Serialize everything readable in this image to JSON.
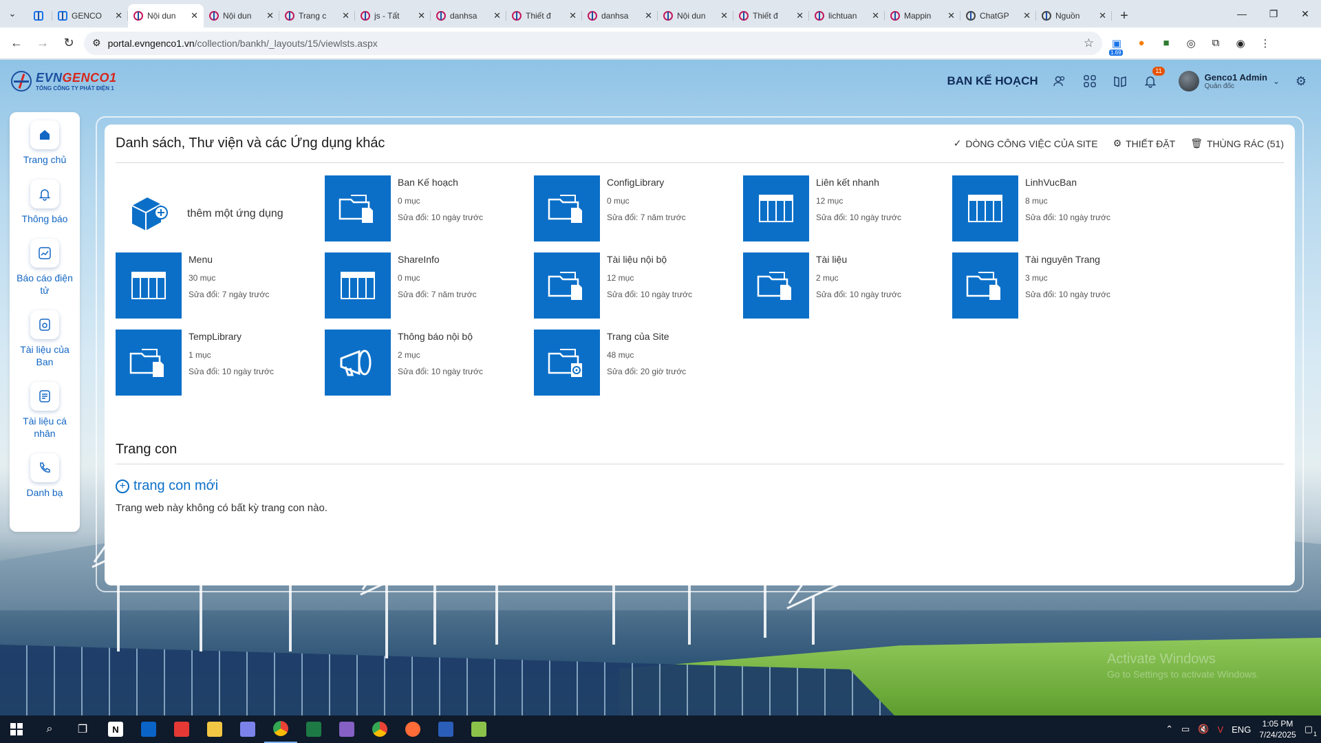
{
  "browser": {
    "tabs": [
      {
        "label": "",
        "icon": "teams-icon",
        "pinned": true
      },
      {
        "label": "GENCO",
        "icon": "sharepoint-icon"
      },
      {
        "label": "Nội dun",
        "icon": "evn-favicon",
        "active": true
      },
      {
        "label": "Nội dun",
        "icon": "evn-favicon"
      },
      {
        "label": "Trang c",
        "icon": "evn-favicon"
      },
      {
        "label": "js - Tất",
        "icon": "evn-favicon"
      },
      {
        "label": "danhsa",
        "icon": "evn-favicon"
      },
      {
        "label": "Thiết đ",
        "icon": "evn-favicon"
      },
      {
        "label": "danhsa",
        "icon": "evn-favicon"
      },
      {
        "label": "Nội dun",
        "icon": "evn-favicon"
      },
      {
        "label": "Thiết đ",
        "icon": "evn-favicon"
      },
      {
        "label": "lichtuan",
        "icon": "evn-favicon"
      },
      {
        "label": "Mappin",
        "icon": "evn-favicon"
      },
      {
        "label": "ChatGP",
        "icon": "chatgpt-icon"
      },
      {
        "label": "Nguồn",
        "icon": "chatgpt-icon"
      }
    ],
    "url_host": "portal.evngenco1.vn",
    "url_path": "/collection/bankh/_layouts/15/viewlsts.aspx",
    "extension_badge": "1.69"
  },
  "header": {
    "logo_name_part1": "EVN",
    "logo_name_part2": "GENCO1",
    "logo_sub": "TỔNG CÔNG TY PHÁT ĐIỆN 1",
    "department": "BAN KẾ HOẠCH",
    "notification_count": "11",
    "user_name": "Genco1 Admin",
    "user_role": "Quản đốc"
  },
  "leftnav": [
    {
      "label": "Trang chủ",
      "icon": "home-icon"
    },
    {
      "label": "Thông báo",
      "icon": "bell-icon"
    },
    {
      "label": "Báo cáo điện tử",
      "icon": "chart-icon"
    },
    {
      "label": "Tài liệu của Ban",
      "icon": "folder-doc-icon"
    },
    {
      "label": "Tài liệu cá nhân",
      "icon": "document-icon"
    },
    {
      "label": "Danh bạ",
      "icon": "phone-icon"
    }
  ],
  "main": {
    "title": "Danh sách, Thư viện và các Ứng dụng khác",
    "actions": {
      "workflows": "DÒNG CÔNG VIỆC CỦA SITE",
      "settings": "THIẾT ĐẶT",
      "recycle": "THÙNG RÁC (51)"
    },
    "add_app_label": "thêm một ứng dụng",
    "tiles": [
      {
        "name": "Ban Kế hoạch",
        "count": "0 mục",
        "modified": "Sửa đổi: 10 ngày trước",
        "kind": "library"
      },
      {
        "name": "ConfigLibrary",
        "count": "0 mục",
        "modified": "Sửa đổi: 7 năm trước",
        "kind": "library"
      },
      {
        "name": "Liên kết nhanh",
        "count": "12 mục",
        "modified": "Sửa đổi: 10 ngày trước",
        "kind": "list"
      },
      {
        "name": "LinhVucBan",
        "count": "8 mục",
        "modified": "Sửa đổi: 10 ngày trước",
        "kind": "list"
      },
      {
        "name": "Menu",
        "count": "30 mục",
        "modified": "Sửa đổi: 7 ngày trước",
        "kind": "list"
      },
      {
        "name": "ShareInfo",
        "count": "0 mục",
        "modified": "Sửa đổi: 7 năm trước",
        "kind": "list"
      },
      {
        "name": "Tài liệu nội bộ",
        "count": "12 mục",
        "modified": "Sửa đổi: 10 ngày trước",
        "kind": "library"
      },
      {
        "name": "Tài liệu",
        "count": "2 mục",
        "modified": "Sửa đổi: 10 ngày trước",
        "kind": "library"
      },
      {
        "name": "Tài nguyên Trang",
        "count": "3 mục",
        "modified": "Sửa đổi: 10 ngày trước",
        "kind": "library"
      },
      {
        "name": "TempLibrary",
        "count": "1 mục",
        "modified": "Sửa đổi: 10 ngày trước",
        "kind": "library"
      },
      {
        "name": "Thông báo nội bộ",
        "count": "2 mục",
        "modified": "Sửa đổi: 10 ngày trước",
        "kind": "announcement"
      },
      {
        "name": "Trang của Site",
        "count": "48 mục",
        "modified": "Sửa đổi: 20 giờ trước",
        "kind": "sitepages"
      }
    ],
    "subsites_title": "Trang con",
    "new_subsite": "trang con mới",
    "no_subsites": "Trang web này không có bất kỳ trang con nào."
  },
  "watermark": {
    "line1": "Activate Windows",
    "line2": "Go to Settings to activate Windows."
  },
  "taskbar": {
    "language": "ENG",
    "time": "1:05 PM",
    "date": "7/24/2025",
    "notification_count": "1"
  },
  "colors": {
    "tile_blue": "#0b6fc8",
    "nav_blue": "#1266c4",
    "brand_red": "#d8261c",
    "brand_blue": "#1b4fa0"
  }
}
